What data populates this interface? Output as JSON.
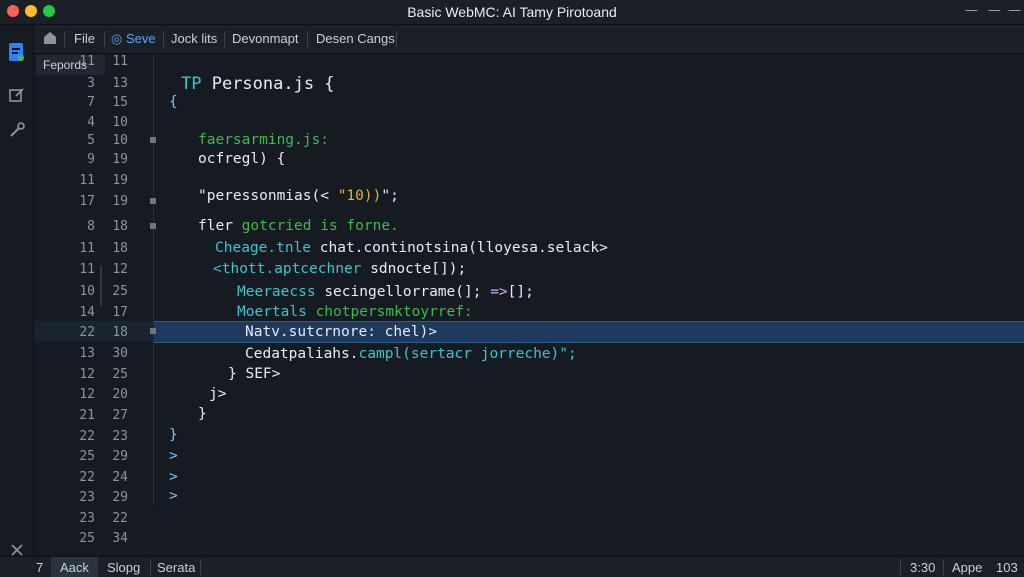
{
  "window": {
    "title": "Basic WebMC: AI Tamy Pirotoand"
  },
  "toolbar": {
    "file": "File",
    "save": "Seve",
    "item3": "Jock lits",
    "item4": "Devonmapt",
    "item5": "Desen Cangs"
  },
  "sidebar": {
    "label": "Fepords"
  },
  "line_numbers_a": [
    "11",
    "3",
    "7",
    "4",
    "5",
    "9",
    "11",
    "17",
    "8",
    "11",
    "11",
    "10",
    "14",
    "22",
    "13",
    "12",
    "12",
    "21",
    "22",
    "25",
    "22",
    "23",
    "23",
    "25"
  ],
  "line_numbers_b": [
    "11",
    "13",
    "15",
    "10",
    "10",
    "19",
    "19",
    "19",
    "18",
    "18",
    "12",
    "25",
    "17",
    "18",
    "30",
    "25",
    "20",
    "27",
    "23",
    "29",
    "24",
    "29",
    "22",
    "34"
  ],
  "code": {
    "l1_a": "TP ",
    "l1_b": "Persona.js {",
    "l2": "{",
    "l3": "faersarming.js:",
    "l4": "ocfregl) {",
    "l5_a": "\"peressonmias(< ",
    "l5_b": "\"10))",
    "l5_c": "\";",
    "l6_a": "fler ",
    "l6_b": "gotcried is forne.",
    "l7_a": "Cheage.tnle ",
    "l7_b": "chat.continotsina(lloyesa.selack>",
    "l8_a": "<thott.aptcechner ",
    "l8_b": "sdnocte[]);",
    "l9_a": "Meeraecss ",
    "l9_b": "secingellorrame(]; ",
    "l9_c": "=>",
    "l9_d": "[];",
    "l10_a": "Moertals ",
    "l10_b": "chotpersmktoyrref:",
    "l11": "Natv.sutcrnore: chel)>",
    "l12_a": "Cedatpaliahs.",
    "l12_b": "campl(sertacr jorreche)\";",
    "l13": "} SEF>",
    "l14": "j>",
    "l15": "}",
    "l16": "}",
    "l17": ">",
    "l18": ">",
    "l19": ">"
  },
  "statusbar": {
    "left_num": "7",
    "tab1": "Aack",
    "tab2": "Slopg",
    "tab3": "Serata",
    "time": "3:30",
    "appe": "Appe",
    "num": "103"
  }
}
